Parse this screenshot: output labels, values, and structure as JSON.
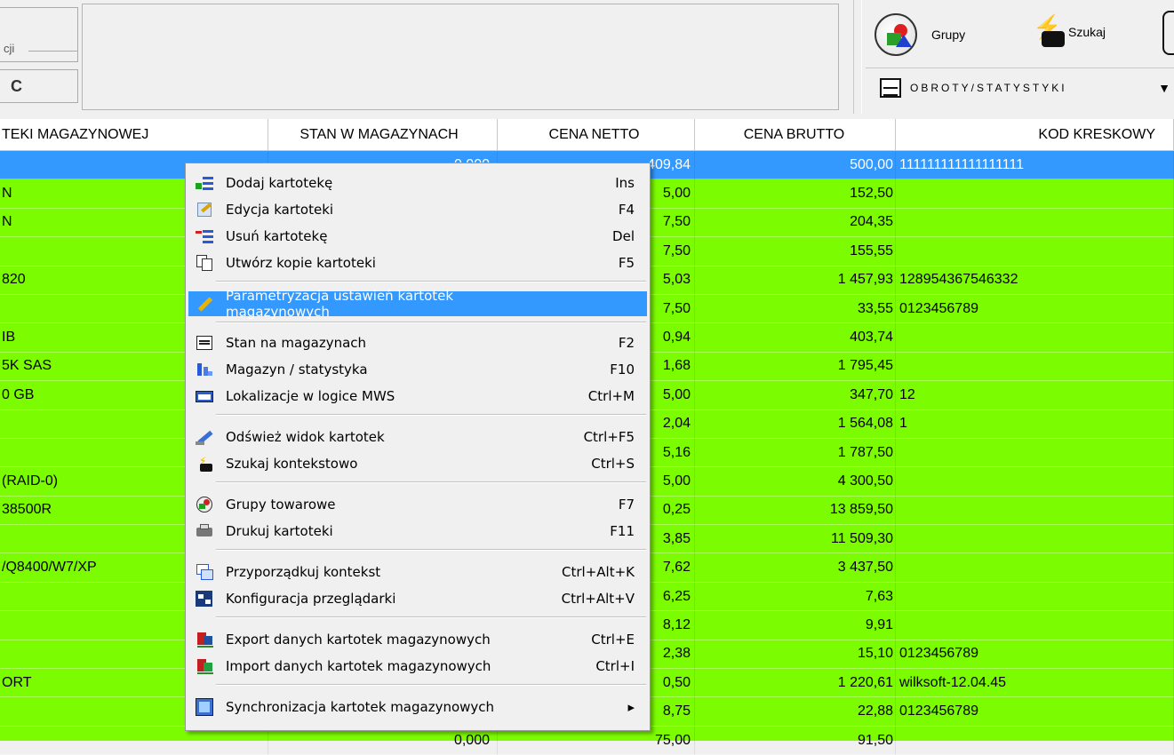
{
  "toolbar": {
    "field_fragment_label": "cji",
    "refresh_glyph": "C",
    "grupy_label": "Grupy",
    "szukaj_label": "Szukaj",
    "obroty_label": "OBROTY/STATYSTYKI"
  },
  "table": {
    "headers": [
      "TEKI MAGAZYNOWEJ",
      "STAN W MAGAZYNACH",
      "CENA NETTO",
      "CENA BRUTTO",
      "KOD KRESKOWY"
    ],
    "rows": [
      [
        "",
        "0,000",
        "409,84",
        "500,00",
        "111111111111111111"
      ],
      [
        "N",
        "",
        "5,00",
        "152,50",
        ""
      ],
      [
        "N",
        "",
        "7,50",
        "204,35",
        ""
      ],
      [
        "",
        "",
        "7,50",
        "155,55",
        ""
      ],
      [
        "820",
        "",
        "5,03",
        "1 457,93",
        "128954367546332"
      ],
      [
        "",
        "",
        "7,50",
        "33,55",
        "0123456789"
      ],
      [
        "IB",
        "",
        "0,94",
        "403,74",
        ""
      ],
      [
        "5K SAS",
        "",
        "1,68",
        "1 795,45",
        ""
      ],
      [
        "0 GB",
        "",
        "5,00",
        "347,70",
        "12"
      ],
      [
        "",
        "",
        "2,04",
        "1 564,08",
        "1"
      ],
      [
        "",
        "",
        "5,16",
        "1 787,50",
        ""
      ],
      [
        "(RAID-0)",
        "",
        "5,00",
        "4 300,50",
        ""
      ],
      [
        "38500R",
        "",
        "0,25",
        "13 859,50",
        ""
      ],
      [
        "",
        "",
        "3,85",
        "11 509,30",
        ""
      ],
      [
        "/Q8400/W7/XP",
        "",
        "7,62",
        "3 437,50",
        ""
      ],
      [
        "",
        "",
        "6,25",
        "7,63",
        ""
      ],
      [
        "",
        "",
        "8,12",
        "9,91",
        ""
      ],
      [
        "",
        "",
        "2,38",
        "15,10",
        "0123456789"
      ],
      [
        "ORT",
        "",
        "0,50",
        "1 220,61",
        "wilksoft-12.04.45"
      ],
      [
        "",
        "",
        "8,75",
        "22,88",
        "0123456789"
      ],
      [
        "",
        "0,000",
        "75,00",
        "91,50",
        ""
      ]
    ]
  },
  "menu": {
    "items": [
      {
        "label": "Dodaj kartotekę",
        "key": "Ins",
        "icon": "add-card-icon"
      },
      {
        "label": "Edycja kartoteki",
        "key": "F4",
        "icon": "edit-card-icon"
      },
      {
        "label": "Usuń kartotekę",
        "key": "Del",
        "icon": "delete-card-icon"
      },
      {
        "label": "Utwórz kopie kartoteki",
        "key": "F5",
        "icon": "copy-card-icon"
      },
      {
        "label": "Parametryzacja ustawień kartotek  magazynowych",
        "key": "",
        "icon": "pencil-icon"
      },
      {
        "label": "Stan na magazynach",
        "key": "F2",
        "icon": "chart-icon"
      },
      {
        "label": "Magazyn / statystyka",
        "key": "F10",
        "icon": "statistics-icon"
      },
      {
        "label": "Lokalizacje w logice MWS",
        "key": "Ctrl+M",
        "icon": "keyboard-icon"
      },
      {
        "label": "Odśwież widok kartotek",
        "key": "Ctrl+F5",
        "icon": "refresh-icon"
      },
      {
        "label": "Szukaj kontekstowo",
        "key": "Ctrl+S",
        "icon": "binoculars-icon"
      },
      {
        "label": "Grupy towarowe",
        "key": "F7",
        "icon": "groups-icon"
      },
      {
        "label": "Drukuj kartoteki",
        "key": "F11",
        "icon": "printer-icon"
      },
      {
        "label": "Przyporządkuj kontekst",
        "key": "Ctrl+Alt+K",
        "icon": "assign-context-icon"
      },
      {
        "label": "Konfiguracja przeglądarki",
        "key": "Ctrl+Alt+V",
        "icon": "browser-config-icon"
      },
      {
        "label": "Export danych kartotek magazynowych",
        "key": "Ctrl+E",
        "icon": "export-icon"
      },
      {
        "label": "Import danych kartotek magazynowych",
        "key": "Ctrl+I",
        "icon": "import-icon"
      },
      {
        "label": "Synchronizacja kartotek magazynowych",
        "key": "▸",
        "icon": "sync-icon"
      }
    ]
  },
  "colors": {
    "row_background": "#7cfc00",
    "selection": "#3399ff",
    "menu_background": "#f0f0f0"
  }
}
